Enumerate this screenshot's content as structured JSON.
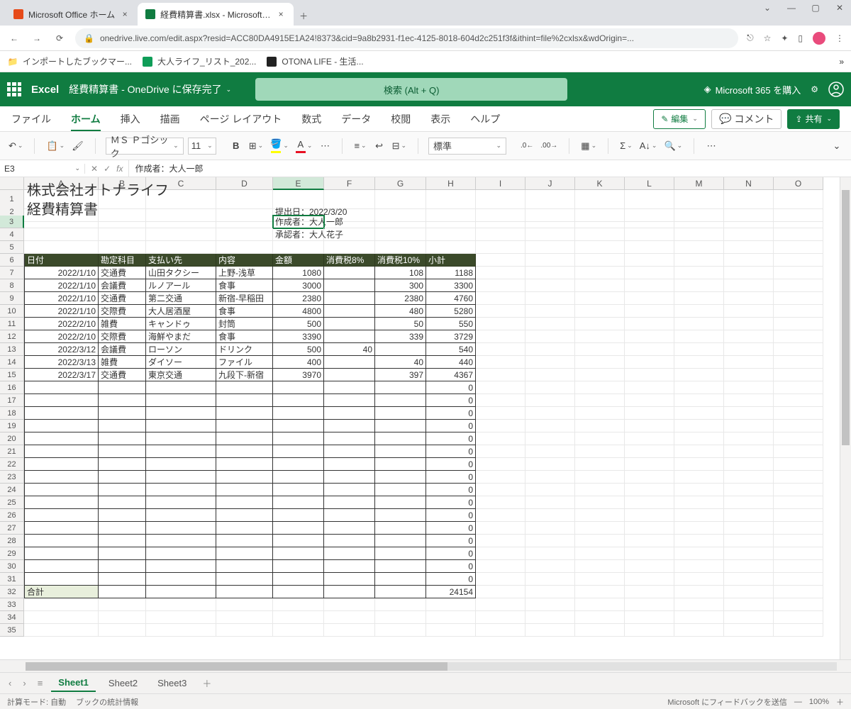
{
  "browser": {
    "tabs": [
      {
        "title": "Microsoft Office ホーム",
        "active": false
      },
      {
        "title": "経費精算書.xlsx - Microsoft Excel",
        "active": true
      }
    ],
    "url": "onedrive.live.com/edit.aspx?resid=ACC80DA4915E1A24!8373&cid=9a8b2931-f1ec-4125-8018-604d2c251f3f&ithint=file%2cxlsx&wdOrigin=...",
    "bookmarks": [
      {
        "label": "インポートしたブックマー..."
      },
      {
        "label": "大人ライフ_リスト_202..."
      },
      {
        "label": "OTONA LIFE - 生活..."
      }
    ]
  },
  "excel": {
    "brand": "Excel",
    "filename": "経費精算書 - OneDrive に保存完了",
    "search_placeholder": "検索 (Alt + Q)",
    "premium": "Microsoft 365 を購入",
    "ribbon_tabs": [
      "ファイル",
      "ホーム",
      "挿入",
      "描画",
      "ページ レイアウト",
      "数式",
      "データ",
      "校閲",
      "表示",
      "ヘルプ"
    ],
    "active_ribbon_tab": "ホーム",
    "edit_button": "編集",
    "comment_button": "コメント",
    "share_button": "共有",
    "font_name": "ＭＳ Ｐゴシック",
    "font_size": "11",
    "number_format": "標準",
    "name_box": "E3",
    "formula": "作成者：大人一郎",
    "columns": [
      "A",
      "B",
      "C",
      "D",
      "E",
      "F",
      "G",
      "H",
      "I",
      "J",
      "K",
      "L",
      "M",
      "N",
      "O"
    ],
    "sheets": [
      "Sheet1",
      "Sheet2",
      "Sheet3"
    ],
    "active_sheet": "Sheet1",
    "status_left": [
      "計算モード: 自動",
      "ブックの統計情報"
    ],
    "status_feedback": "Microsoft にフィードバックを送信",
    "zoom": "100%"
  },
  "doc": {
    "title": "株式会社オトナライフ",
    "subtitle": "経費精算書",
    "submit_date": "提出日：2022/3/20",
    "creator": "作成者：大人一郎",
    "approver": "承認者：大人花子",
    "headers": [
      "日付",
      "勘定科目",
      "支払い先",
      "内容",
      "金額",
      "消費税8%",
      "消費税10%",
      "小計"
    ],
    "rows": [
      {
        "date": "2022/1/10",
        "account": "交通費",
        "payee": "山田タクシー",
        "desc": "上野-浅草",
        "amount": "1080",
        "tax8": "",
        "tax10": "108",
        "sub": "1188"
      },
      {
        "date": "2022/1/10",
        "account": "会議費",
        "payee": "ルノアール",
        "desc": "食事",
        "amount": "3000",
        "tax8": "",
        "tax10": "300",
        "sub": "3300"
      },
      {
        "date": "2022/1/10",
        "account": "交通費",
        "payee": "第二交通",
        "desc": "新宿-早稲田",
        "amount": "2380",
        "tax8": "",
        "tax10": "2380",
        "sub": "4760"
      },
      {
        "date": "2022/1/10",
        "account": "交際費",
        "payee": "大人居酒屋",
        "desc": "食事",
        "amount": "4800",
        "tax8": "",
        "tax10": "480",
        "sub": "5280"
      },
      {
        "date": "2022/2/10",
        "account": "雑費",
        "payee": "キャンドゥ",
        "desc": "封筒",
        "amount": "500",
        "tax8": "",
        "tax10": "50",
        "sub": "550"
      },
      {
        "date": "2022/2/10",
        "account": "交際費",
        "payee": "海鮮やまだ",
        "desc": "食事",
        "amount": "3390",
        "tax8": "",
        "tax10": "339",
        "sub": "3729"
      },
      {
        "date": "2022/3/12",
        "account": "会議費",
        "payee": "ローソン",
        "desc": "ドリンク",
        "amount": "500",
        "tax8": "40",
        "tax10": "",
        "sub": "540"
      },
      {
        "date": "2022/3/13",
        "account": "雑費",
        "payee": "ダイソー",
        "desc": "ファイル",
        "amount": "400",
        "tax8": "",
        "tax10": "40",
        "sub": "440"
      },
      {
        "date": "2022/3/17",
        "account": "交通費",
        "payee": "東京交通",
        "desc": "九段下-新宿",
        "amount": "3970",
        "tax8": "",
        "tax10": "397",
        "sub": "4367"
      }
    ],
    "empty_subtotals": [
      "0",
      "0",
      "0",
      "0",
      "0",
      "0",
      "0",
      "0",
      "0",
      "0",
      "0",
      "0",
      "0",
      "0",
      "0",
      "0"
    ],
    "total_label": "合計",
    "total_value": "24154"
  }
}
